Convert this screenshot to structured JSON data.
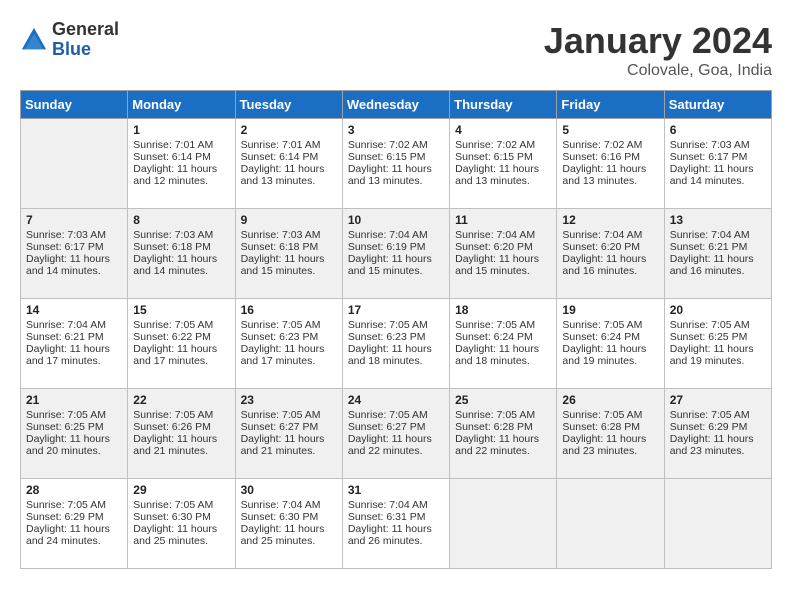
{
  "header": {
    "logo_general": "General",
    "logo_blue": "Blue",
    "month_title": "January 2024",
    "location": "Colovale, Goa, India"
  },
  "days_of_week": [
    "Sunday",
    "Monday",
    "Tuesday",
    "Wednesday",
    "Thursday",
    "Friday",
    "Saturday"
  ],
  "weeks": [
    [
      {
        "day": "",
        "sunrise": "",
        "sunset": "",
        "daylight": "",
        "empty": true
      },
      {
        "day": "1",
        "sunrise": "Sunrise: 7:01 AM",
        "sunset": "Sunset: 6:14 PM",
        "daylight": "Daylight: 11 hours and 12 minutes."
      },
      {
        "day": "2",
        "sunrise": "Sunrise: 7:01 AM",
        "sunset": "Sunset: 6:14 PM",
        "daylight": "Daylight: 11 hours and 13 minutes."
      },
      {
        "day": "3",
        "sunrise": "Sunrise: 7:02 AM",
        "sunset": "Sunset: 6:15 PM",
        "daylight": "Daylight: 11 hours and 13 minutes."
      },
      {
        "day": "4",
        "sunrise": "Sunrise: 7:02 AM",
        "sunset": "Sunset: 6:15 PM",
        "daylight": "Daylight: 11 hours and 13 minutes."
      },
      {
        "day": "5",
        "sunrise": "Sunrise: 7:02 AM",
        "sunset": "Sunset: 6:16 PM",
        "daylight": "Daylight: 11 hours and 13 minutes."
      },
      {
        "day": "6",
        "sunrise": "Sunrise: 7:03 AM",
        "sunset": "Sunset: 6:17 PM",
        "daylight": "Daylight: 11 hours and 14 minutes."
      }
    ],
    [
      {
        "day": "7",
        "sunrise": "Sunrise: 7:03 AM",
        "sunset": "Sunset: 6:17 PM",
        "daylight": "Daylight: 11 hours and 14 minutes."
      },
      {
        "day": "8",
        "sunrise": "Sunrise: 7:03 AM",
        "sunset": "Sunset: 6:18 PM",
        "daylight": "Daylight: 11 hours and 14 minutes."
      },
      {
        "day": "9",
        "sunrise": "Sunrise: 7:03 AM",
        "sunset": "Sunset: 6:18 PM",
        "daylight": "Daylight: 11 hours and 15 minutes."
      },
      {
        "day": "10",
        "sunrise": "Sunrise: 7:04 AM",
        "sunset": "Sunset: 6:19 PM",
        "daylight": "Daylight: 11 hours and 15 minutes."
      },
      {
        "day": "11",
        "sunrise": "Sunrise: 7:04 AM",
        "sunset": "Sunset: 6:20 PM",
        "daylight": "Daylight: 11 hours and 15 minutes."
      },
      {
        "day": "12",
        "sunrise": "Sunrise: 7:04 AM",
        "sunset": "Sunset: 6:20 PM",
        "daylight": "Daylight: 11 hours and 16 minutes."
      },
      {
        "day": "13",
        "sunrise": "Sunrise: 7:04 AM",
        "sunset": "Sunset: 6:21 PM",
        "daylight": "Daylight: 11 hours and 16 minutes."
      }
    ],
    [
      {
        "day": "14",
        "sunrise": "Sunrise: 7:04 AM",
        "sunset": "Sunset: 6:21 PM",
        "daylight": "Daylight: 11 hours and 17 minutes."
      },
      {
        "day": "15",
        "sunrise": "Sunrise: 7:05 AM",
        "sunset": "Sunset: 6:22 PM",
        "daylight": "Daylight: 11 hours and 17 minutes."
      },
      {
        "day": "16",
        "sunrise": "Sunrise: 7:05 AM",
        "sunset": "Sunset: 6:23 PM",
        "daylight": "Daylight: 11 hours and 17 minutes."
      },
      {
        "day": "17",
        "sunrise": "Sunrise: 7:05 AM",
        "sunset": "Sunset: 6:23 PM",
        "daylight": "Daylight: 11 hours and 18 minutes."
      },
      {
        "day": "18",
        "sunrise": "Sunrise: 7:05 AM",
        "sunset": "Sunset: 6:24 PM",
        "daylight": "Daylight: 11 hours and 18 minutes."
      },
      {
        "day": "19",
        "sunrise": "Sunrise: 7:05 AM",
        "sunset": "Sunset: 6:24 PM",
        "daylight": "Daylight: 11 hours and 19 minutes."
      },
      {
        "day": "20",
        "sunrise": "Sunrise: 7:05 AM",
        "sunset": "Sunset: 6:25 PM",
        "daylight": "Daylight: 11 hours and 19 minutes."
      }
    ],
    [
      {
        "day": "21",
        "sunrise": "Sunrise: 7:05 AM",
        "sunset": "Sunset: 6:25 PM",
        "daylight": "Daylight: 11 hours and 20 minutes."
      },
      {
        "day": "22",
        "sunrise": "Sunrise: 7:05 AM",
        "sunset": "Sunset: 6:26 PM",
        "daylight": "Daylight: 11 hours and 21 minutes."
      },
      {
        "day": "23",
        "sunrise": "Sunrise: 7:05 AM",
        "sunset": "Sunset: 6:27 PM",
        "daylight": "Daylight: 11 hours and 21 minutes."
      },
      {
        "day": "24",
        "sunrise": "Sunrise: 7:05 AM",
        "sunset": "Sunset: 6:27 PM",
        "daylight": "Daylight: 11 hours and 22 minutes."
      },
      {
        "day": "25",
        "sunrise": "Sunrise: 7:05 AM",
        "sunset": "Sunset: 6:28 PM",
        "daylight": "Daylight: 11 hours and 22 minutes."
      },
      {
        "day": "26",
        "sunrise": "Sunrise: 7:05 AM",
        "sunset": "Sunset: 6:28 PM",
        "daylight": "Daylight: 11 hours and 23 minutes."
      },
      {
        "day": "27",
        "sunrise": "Sunrise: 7:05 AM",
        "sunset": "Sunset: 6:29 PM",
        "daylight": "Daylight: 11 hours and 23 minutes."
      }
    ],
    [
      {
        "day": "28",
        "sunrise": "Sunrise: 7:05 AM",
        "sunset": "Sunset: 6:29 PM",
        "daylight": "Daylight: 11 hours and 24 minutes."
      },
      {
        "day": "29",
        "sunrise": "Sunrise: 7:05 AM",
        "sunset": "Sunset: 6:30 PM",
        "daylight": "Daylight: 11 hours and 25 minutes."
      },
      {
        "day": "30",
        "sunrise": "Sunrise: 7:04 AM",
        "sunset": "Sunset: 6:30 PM",
        "daylight": "Daylight: 11 hours and 25 minutes."
      },
      {
        "day": "31",
        "sunrise": "Sunrise: 7:04 AM",
        "sunset": "Sunset: 6:31 PM",
        "daylight": "Daylight: 11 hours and 26 minutes."
      },
      {
        "day": "",
        "sunrise": "",
        "sunset": "",
        "daylight": "",
        "empty": true
      },
      {
        "day": "",
        "sunrise": "",
        "sunset": "",
        "daylight": "",
        "empty": true
      },
      {
        "day": "",
        "sunrise": "",
        "sunset": "",
        "daylight": "",
        "empty": true
      }
    ]
  ]
}
